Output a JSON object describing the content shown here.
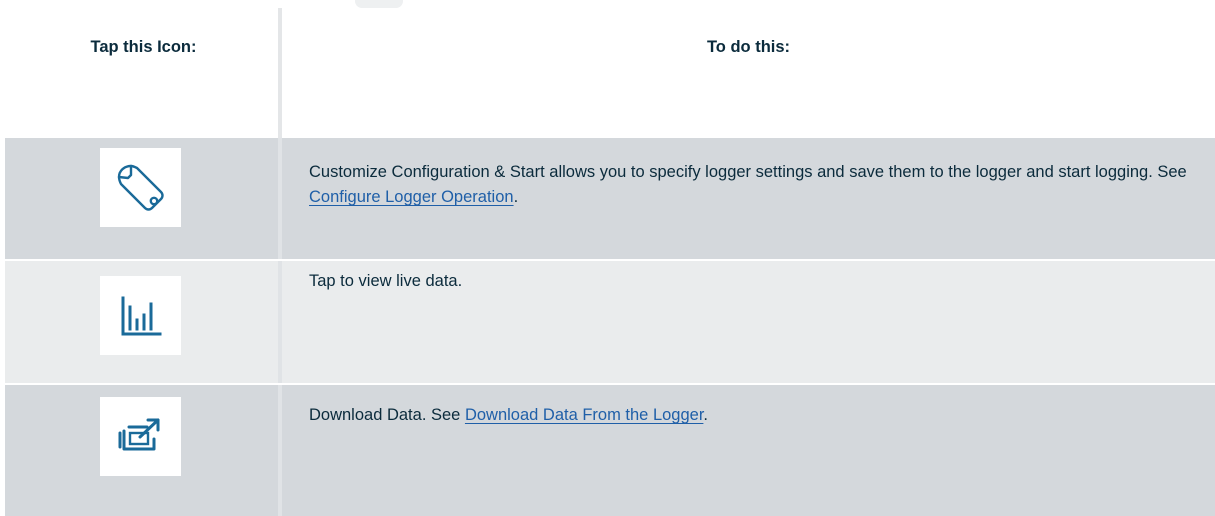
{
  "table": {
    "header": {
      "col1": "Tap this Icon:",
      "col2": "To do this:"
    },
    "rows": [
      {
        "icon": "wrench-icon",
        "text_before": "Customize Configuration & Start allows you to specify logger settings and save them to the logger and start logging. See ",
        "link": "Configure Logger Operation",
        "text_after": "."
      },
      {
        "icon": "bar-chart-icon",
        "text_before": "Tap to view live data.",
        "link": "",
        "text_after": ""
      },
      {
        "icon": "download-export-icon",
        "text_before": "Download Data. See ",
        "link": "Download Data From the Logger",
        "text_after": "."
      }
    ]
  },
  "colors": {
    "text": "#0b2b3c",
    "link": "#1f5fa8",
    "icon": "#1a6a99",
    "row_dark": "#d4d8dc",
    "row_light": "#eaeced"
  }
}
